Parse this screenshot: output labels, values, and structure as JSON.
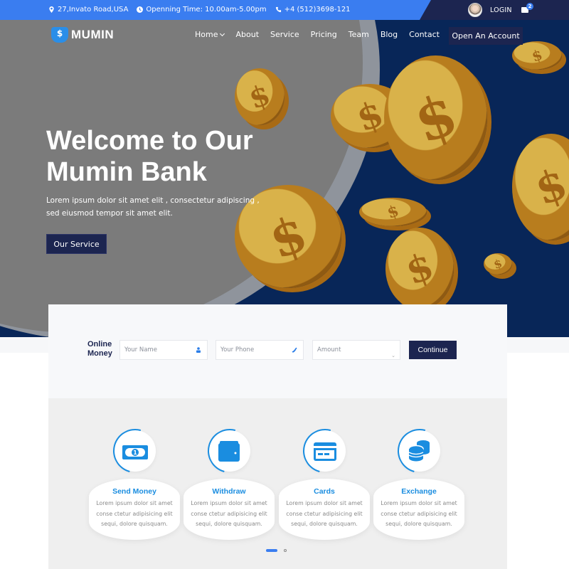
{
  "topbar": {
    "address": "27,Invato Road,USA",
    "hours": "Openning Time: 10.00am-5.00pm",
    "phone": "+4 (512)3698-121",
    "login_label": "LOGIN",
    "mail_count": "2"
  },
  "brand": {
    "name": "MUMIN"
  },
  "nav": {
    "items": [
      {
        "label": "Home",
        "has_dropdown": true
      },
      {
        "label": "About"
      },
      {
        "label": "Service"
      },
      {
        "label": "Pricing"
      },
      {
        "label": "Team"
      },
      {
        "label": "Blog"
      },
      {
        "label": "Contact"
      }
    ],
    "cta_label": "Open An Account"
  },
  "hero": {
    "title": "Welcome to Our Mumin Bank",
    "description": "Lorem ipsum dolor sit amet elit , consectetur adipiscing , sed eiusmod tempor sit amet elit.",
    "button_label": "Our Service"
  },
  "money_form": {
    "label": "Online Money",
    "name_placeholder": "Your Name",
    "phone_placeholder": "Your Phone",
    "amount_selected": "Amount",
    "submit_label": "Continue"
  },
  "services": {
    "items": [
      {
        "icon": "banknote-icon",
        "title": "Send Money",
        "text": "Lorem ipsum dolor sit amet conse ctetur adipisicing elit sequi, dolore quisquam."
      },
      {
        "icon": "wallet-icon",
        "title": "Withdraw",
        "text": "Lorem ipsum dolor sit amet conse ctetur adipisicing elit sequi, dolore quisquam."
      },
      {
        "icon": "credit-card-icon",
        "title": "Cards",
        "text": "Lorem ipsum dolor sit amet conse ctetur adipisicing elit sequi, dolore quisquam."
      },
      {
        "icon": "coins-icon",
        "title": "Exchange",
        "text": "Lorem ipsum dolor sit amet conse ctetur adipisicing elit sequi, dolore quisquam."
      }
    ],
    "carousel": {
      "pages": 2,
      "active": 1
    }
  },
  "colors": {
    "topbar_blue": "#3a7df0",
    "navy": "#1c2550",
    "hero_blue": "#082658",
    "accent": "#1a8de0"
  }
}
